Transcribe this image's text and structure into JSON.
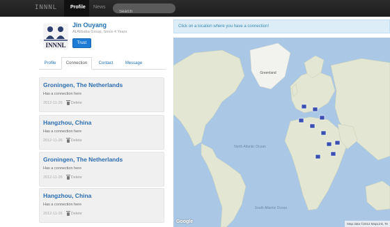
{
  "nav": {
    "brand": "INNNL",
    "items": [
      {
        "label": "Profile",
        "active": true
      },
      {
        "label": "News",
        "active": false
      }
    ],
    "search_placeholder": "Search"
  },
  "profile": {
    "name": "Jin Ouyang",
    "subtitle": "At Alibaba Group, Since 4 Years",
    "avatar_text": "INNNL",
    "trust_label": "Trust"
  },
  "tabs": [
    {
      "label": "Profile",
      "active": false
    },
    {
      "label": "Connection",
      "active": true
    },
    {
      "label": "Contact",
      "active": false
    },
    {
      "label": "Message",
      "active": false
    }
  ],
  "connections": [
    {
      "title": "Groningen, The Netherlands",
      "description": "Has a connection here",
      "date": "2012-11-26",
      "delete_label": "Delete"
    },
    {
      "title": "Hangzhou, China",
      "description": "Has a connection here",
      "date": "2012-11-26",
      "delete_label": "Delete"
    },
    {
      "title": "Groningen, The Netherlands",
      "description": "Has a connection here",
      "date": "2012-11-26",
      "delete_label": "Delete"
    },
    {
      "title": "Hangzhou, China",
      "description": "Has a connection here",
      "date": "2012-11-26",
      "delete_label": "Delete"
    }
  ],
  "map": {
    "hint": "Click on a location where you have a connection!",
    "logo": "Google",
    "attribution": "Map data ©2012 MapLink, Te",
    "labels": {
      "greenland": "Greenland",
      "atlantic": "North Atlantic Ocean",
      "south_atlantic": "South Atlantic Ocean"
    },
    "marker_icon": "building-pin-icon"
  },
  "colors": {
    "navbar": "#1c1c1c",
    "link": "#1f6fb5",
    "button": "#1e7bd6",
    "map_water": "#aac8e6",
    "map_land": "#dfe4cf",
    "marker": "#3b4fb0"
  }
}
